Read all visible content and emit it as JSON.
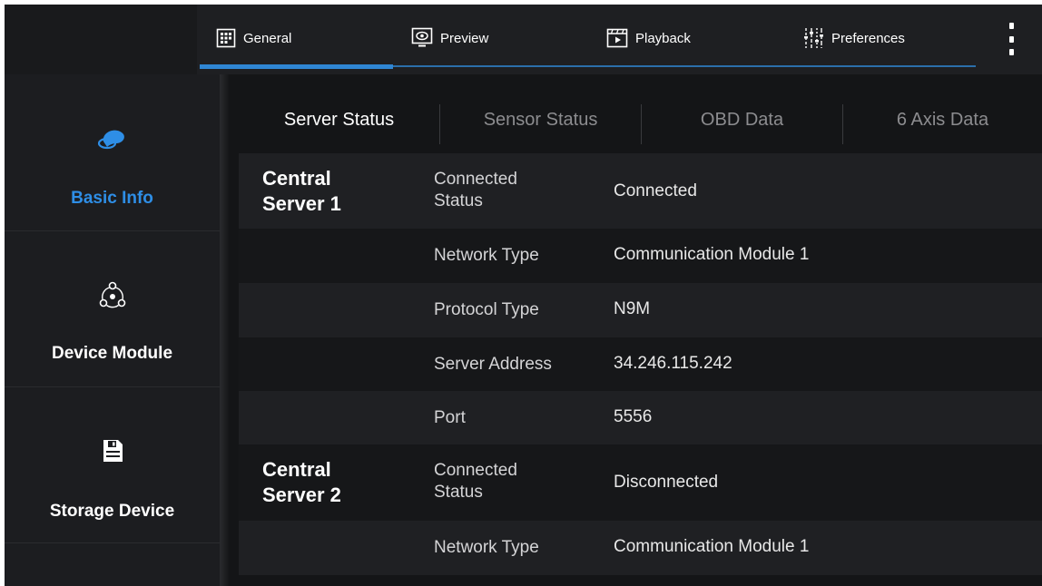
{
  "topbar": {
    "tabs": [
      {
        "label": "General",
        "icon": "general-icon"
      },
      {
        "label": "Preview",
        "icon": "preview-icon"
      },
      {
        "label": "Playback",
        "icon": "playback-icon"
      },
      {
        "label": "Preferences",
        "icon": "preferences-icon"
      }
    ],
    "active_tab": "General",
    "more_icon": "more-vertical-icon"
  },
  "sidebar": {
    "items": [
      {
        "label": "Basic Info",
        "icon": "basic-info-icon",
        "active": true
      },
      {
        "label": "Device Module",
        "icon": "device-module-icon",
        "active": false
      },
      {
        "label": "Storage Device",
        "icon": "storage-device-icon",
        "active": false
      }
    ]
  },
  "subtabs": [
    {
      "label": "Server Status",
      "active": true
    },
    {
      "label": "Sensor Status",
      "active": false
    },
    {
      "label": "OBD Data",
      "active": false
    },
    {
      "label": "6 Axis Data",
      "active": false
    }
  ],
  "servers": [
    {
      "name_line1": "Central",
      "name_line2": "Server 1",
      "rows": [
        {
          "key_line1": "Connected",
          "key_line2": "Status",
          "value": "Connected"
        },
        {
          "key": "Network Type",
          "value": "Communication Module 1"
        },
        {
          "key": "Protocol Type",
          "value": "N9M"
        },
        {
          "key": "Server Address",
          "value": "34.246.115.242"
        },
        {
          "key": "Port",
          "value": "5556"
        }
      ]
    },
    {
      "name_line1": "Central",
      "name_line2": "Server 2",
      "rows": [
        {
          "key_line1": "Connected",
          "key_line2": "Status",
          "value": "Disconnected"
        },
        {
          "key": "Network Type",
          "value": "Communication Module 1"
        }
      ]
    }
  ],
  "colors": {
    "accent": "#2e8ee6",
    "background": "#141517",
    "row_dark": "#1f2023",
    "row_light": "#161719"
  }
}
